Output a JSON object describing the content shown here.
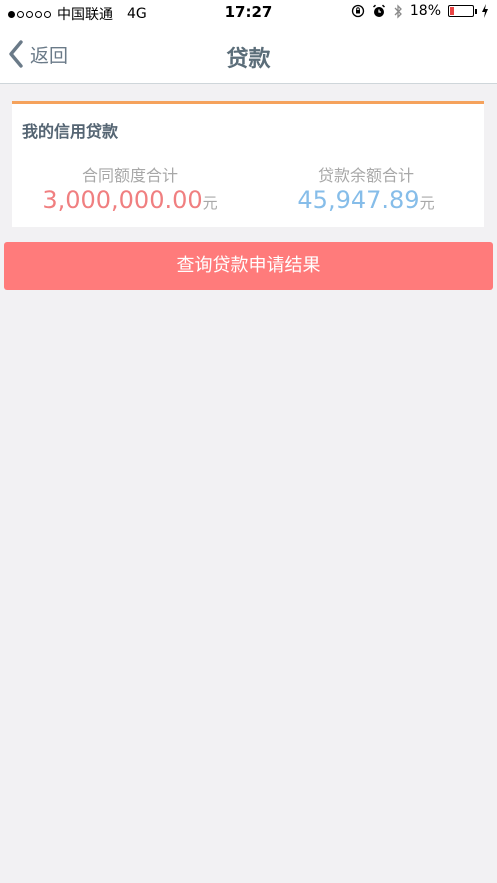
{
  "status_bar": {
    "carrier": "中国联通",
    "network": "4G",
    "time": "17:27",
    "battery_percent": "18%",
    "battery_level": 0.18,
    "icons": [
      "orientation-lock-icon",
      "alarm-icon",
      "bluetooth-icon",
      "charging-icon"
    ]
  },
  "nav": {
    "back_label": "返回",
    "title": "贷款"
  },
  "card": {
    "title": "我的信用贷款",
    "contract_label": "合同额度合计",
    "contract_value": "3,000,000.00",
    "contract_unit": "元",
    "balance_label": "贷款余额合计",
    "balance_value": "45,947.89",
    "balance_unit": "元",
    "accent_color": "#f5a25c"
  },
  "actions": {
    "query_label": "查询贷款申请结果",
    "query_color": "#ff7b7b"
  }
}
